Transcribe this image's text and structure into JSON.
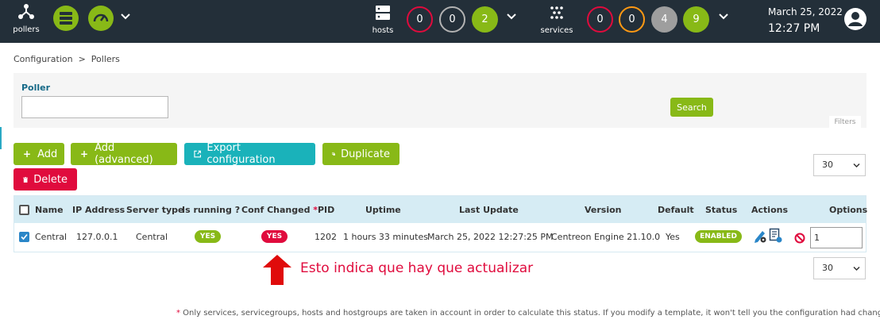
{
  "topbar": {
    "pollers_label": "pollers",
    "hosts_label": "hosts",
    "services_label": "services",
    "hosts_counts": {
      "down": "0",
      "unreachable": "0",
      "up": "2"
    },
    "services_counts": {
      "critical": "0",
      "warning": "0",
      "unknown": "4",
      "ok": "9"
    },
    "date": "March 25, 2022",
    "time": "12:27 PM"
  },
  "breadcrumb": "Configuration  >  Pollers",
  "filters": {
    "poller_label": "Poller",
    "poller_value": "",
    "search_label": "Search",
    "tab_label": "Filters"
  },
  "actions": {
    "add": "Add",
    "add_advanced": "Add (advanced)",
    "export": "Export configuration",
    "duplicate": "Duplicate",
    "delete": "Delete",
    "page_size_top": "30",
    "page_size_bottom": "30"
  },
  "table": {
    "headers": {
      "name": "Name",
      "ip": "IP Address",
      "server_type": "Server type",
      "is_running": "Is running ?",
      "conf_changed": "Conf Changed",
      "conf_star": "*",
      "pid": "PID",
      "uptime": "Uptime",
      "last_update": "Last Update",
      "version": "Version",
      "default": "Default",
      "status": "Status",
      "actions": "Actions",
      "options": "Options"
    },
    "rows": [
      {
        "name": "Central",
        "ip": "127.0.0.1",
        "server_type": "Central",
        "is_running": "YES",
        "conf_changed": "YES",
        "pid": "1202",
        "uptime": "1 hours 33 minutes",
        "last_update": "March 25, 2022 12:27:25 PM",
        "version": "Centreon Engine 21.10.0",
        "default": "Yes",
        "status": "ENABLED",
        "option_value": "1"
      }
    ]
  },
  "annotation": "Esto indica que hay que actualizar",
  "footnote": {
    "star": "*",
    "text": " Only services, servicegroups, hosts and hostgroups are taken in account in order to calculate this status. If you modify a template, it won't tell you the configuration had changed."
  },
  "colors": {
    "topbar": "#232f39",
    "green": "#88b917",
    "teal": "#1ab2ba",
    "red": "#e00b3d",
    "table_header": "#d6ecf4"
  }
}
